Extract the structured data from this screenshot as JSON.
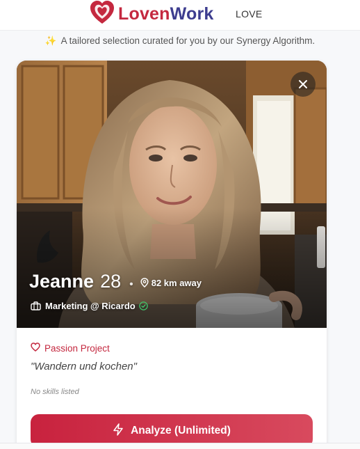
{
  "header": {
    "logo_text_part1": "Loven",
    "logo_text_part2": "Work",
    "nav_label": "LOVE",
    "logo_icon": "heart-logo-icon"
  },
  "tagline": {
    "icon": "sparkles-icon",
    "text": "A tailored selection curated for you by our Synergy Algorithm."
  },
  "profile": {
    "name": "Jeanne",
    "age": "28",
    "separator": "•",
    "distance": "82 km away",
    "distance_icon": "location-pin-icon",
    "job": "Marketing @ Ricardo",
    "job_icon": "briefcase-icon",
    "verified_icon": "verified-check-icon",
    "close_icon": "close-icon"
  },
  "passion": {
    "heading": "Passion Project",
    "icon": "heart-outline-icon",
    "quote": "\"Wandern und kochen\""
  },
  "skills": {
    "empty_text": "No skills listed"
  },
  "actions": {
    "analyze_label": "Analyze (Unlimited)",
    "analyze_icon": "lightning-icon"
  },
  "colors": {
    "brand_red": "#c4283f",
    "brand_navy": "#3d3d8f",
    "button_gradient_start": "#c8223e",
    "button_gradient_end": "#d84a5e",
    "verified_green": "#3fc56a"
  }
}
